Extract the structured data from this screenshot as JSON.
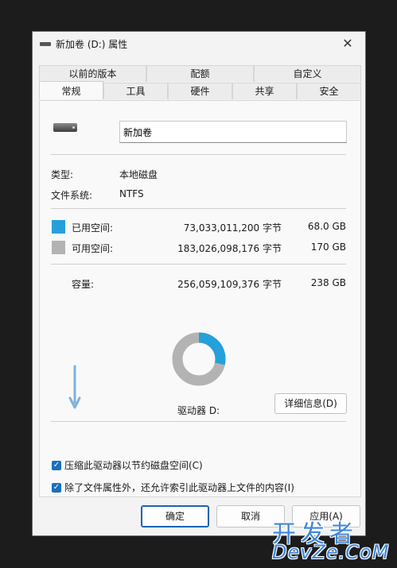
{
  "window": {
    "title": "新加卷 (D:) 属性",
    "close_glyph": "✕"
  },
  "tabs_back": [
    "以前的版本",
    "配额",
    "自定义"
  ],
  "tabs_front": [
    "常规",
    "工具",
    "硬件",
    "共享",
    "安全"
  ],
  "active_tab": "常规",
  "volume_name": "新加卷",
  "info": {
    "type_label": "类型:",
    "type_value": "本地磁盘",
    "fs_label": "文件系统:",
    "fs_value": "NTFS"
  },
  "used": {
    "label": "已用空间:",
    "bytes": "73,033,011,200 字节",
    "size": "68.0 GB",
    "color": "#26a0da"
  },
  "free": {
    "label": "可用空间:",
    "bytes": "183,026,098,176 字节",
    "size": "170 GB",
    "color": "#b3b3b3"
  },
  "capacity": {
    "label": "容量:",
    "bytes": "256,059,109,376 字节",
    "size": "238 GB"
  },
  "used_fraction": 0.285,
  "drive_label": "驱动器 D:",
  "details_button": "详细信息(D)",
  "checkboxes": [
    {
      "label": "压缩此驱动器以节约磁盘空间(C)",
      "checked": true
    },
    {
      "label": "除了文件属性外，还允许索引此驱动器上文件的内容(I)",
      "checked": true
    }
  ],
  "buttons": {
    "ok": "确定",
    "cancel": "取消",
    "apply": "应用(A)"
  },
  "watermark": {
    "line1": "开发者",
    "line2": "DevZe.CoM"
  },
  "accent_color": "#1a6fc1"
}
